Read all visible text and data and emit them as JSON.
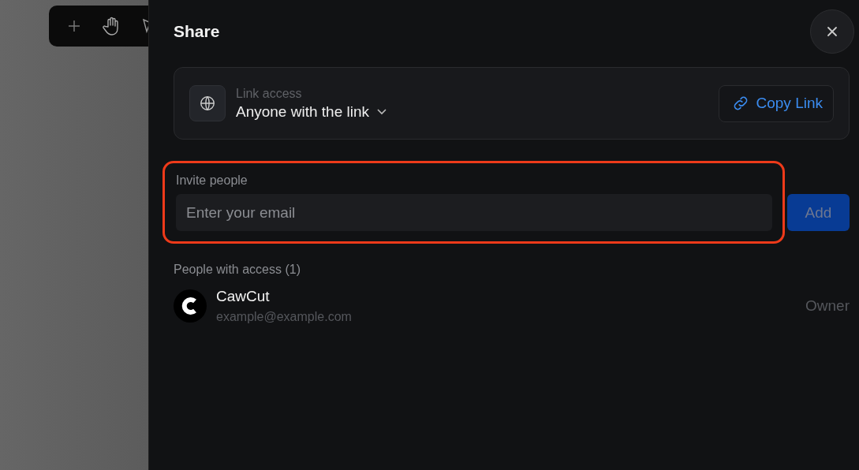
{
  "dialog": {
    "title": "Share"
  },
  "link_access": {
    "label": "Link access",
    "value": "Anyone with the link",
    "button": "Copy Link"
  },
  "invite": {
    "label": "Invite people",
    "placeholder": "Enter your email",
    "button": "Add",
    "disabled": true,
    "highlighted": true
  },
  "people": {
    "heading": "People with access (1)",
    "items": [
      {
        "name": "CawCut",
        "email": "example@example.com",
        "role": "Owner"
      }
    ]
  }
}
